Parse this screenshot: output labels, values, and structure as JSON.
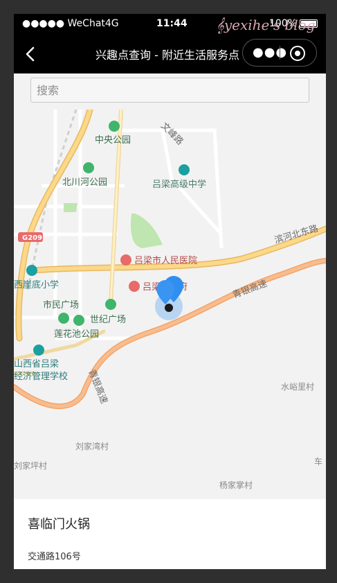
{
  "status_bar": {
    "carrier": "●●●●● WeChat4G",
    "time": "11:44",
    "battery": "100%",
    "watermark": "yexihe's blog"
  },
  "nav": {
    "title": "兴趣点查询 - 附近生活服务点",
    "more_icon": "●●●",
    "back_icon": "chevron-left-icon",
    "capsule_icon": "target-icon"
  },
  "search": {
    "placeholder": "搜索",
    "value": ""
  },
  "map": {
    "labels": {
      "zhongyang": "中央公园",
      "wenfeng": "文峰路",
      "beichuan": "北川河公园",
      "gaozhong": "吕梁高级中学",
      "g209": "G209",
      "binhe": "滨河北东路",
      "hospital": "吕梁市人民医院",
      "gov": "吕梁市政府",
      "yaiyadi": "西崖底小学",
      "shimin": "市民广场",
      "shiji": "世纪广场",
      "qingyin": "青银高速",
      "lianhuachi": "莲花池公园",
      "school1": "山西省吕梁",
      "school2": "经济管理学校",
      "qingyin2": "青银高速",
      "shuiyu": "水峪里村",
      "liujiawan": "刘家湾村",
      "jiaping": "刘家坪村",
      "yangjiazhang": "杨家掌村",
      "che": "车"
    },
    "colors": {
      "highway": "#f5c66e",
      "expressway": "#f6b47e",
      "poi_green": "#3fb56c",
      "poi_teal": "#1aa0a0",
      "poi_red": "#e86a6a",
      "marker": "#2f8ff0"
    }
  },
  "selected_place": {
    "name": "喜临门火锅",
    "address": "交通路106号"
  }
}
